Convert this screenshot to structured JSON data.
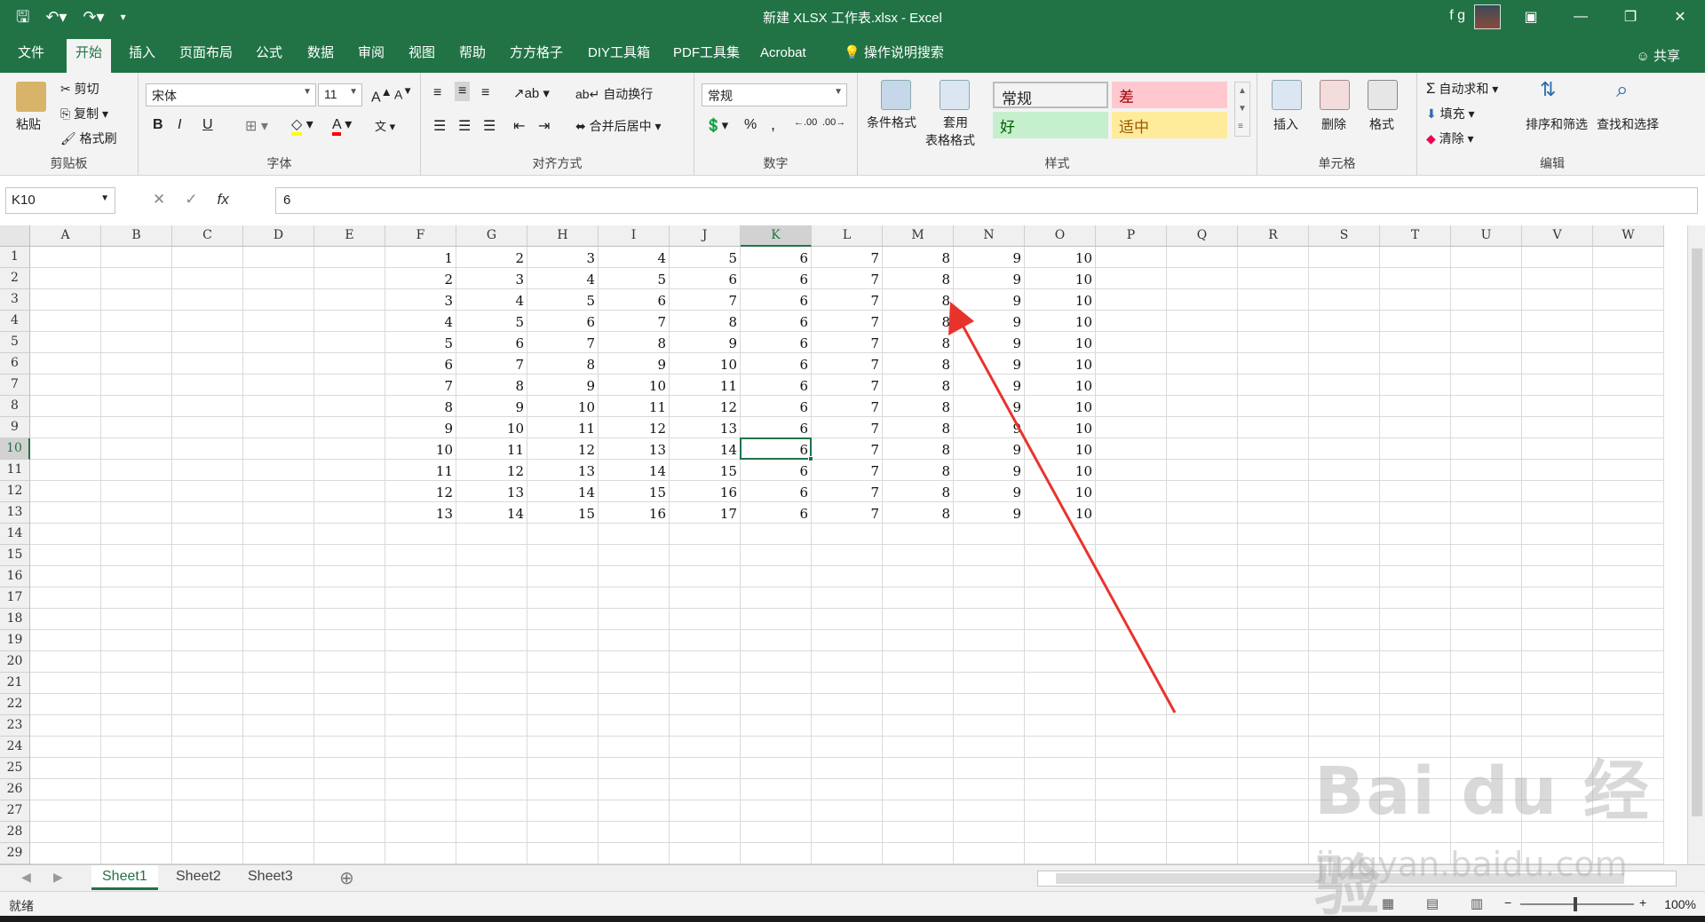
{
  "titlebar": {
    "title": "新建 XLSX 工作表.xlsx  -  Excel",
    "user": "f g",
    "qat": [
      "save-icon",
      "undo-icon",
      "redo-icon",
      "customize-icon"
    ],
    "window_buttons": [
      "ribbon-display-icon",
      "minimize-icon",
      "restore-icon",
      "close-icon"
    ]
  },
  "tabs": [
    "文件",
    "开始",
    "插入",
    "页面布局",
    "公式",
    "数据",
    "审阅",
    "视图",
    "帮助",
    "方方格子",
    "DIY工具箱",
    "PDF工具集",
    "Acrobat",
    "操作说明搜索"
  ],
  "active_tab": "开始",
  "share_label": "共享",
  "ribbon": {
    "clipboard": {
      "label": "剪贴板",
      "paste": "粘贴",
      "cut": "剪切",
      "copy": "复制",
      "format_painter": "格式刷"
    },
    "font": {
      "label": "字体",
      "font_name": "宋体",
      "font_size": "11",
      "bold": "B",
      "italic": "I",
      "underline": "U"
    },
    "alignment": {
      "label": "对齐方式",
      "wrap": "自动换行",
      "merge": "合并后居中"
    },
    "number": {
      "label": "数字",
      "format": "常规",
      "percent": "%",
      "comma": ","
    },
    "styles": {
      "label": "样式",
      "conditional": "条件格式",
      "table_line1": "套用",
      "table_line2": "表格格式",
      "cells": [
        {
          "label": "常规",
          "bg": "#ffffff",
          "fg": "#222222"
        },
        {
          "label": "差",
          "bg": "#ffc7ce",
          "fg": "#9c0006"
        },
        {
          "label": "好",
          "bg": "#c6efce",
          "fg": "#006100"
        },
        {
          "label": "适中",
          "bg": "#ffeb9c",
          "fg": "#9c5700"
        }
      ]
    },
    "cells_group": {
      "label": "单元格",
      "insert": "插入",
      "delete": "删除",
      "format": "格式"
    },
    "editing": {
      "label": "编辑",
      "autosum": "自动求和",
      "fill": "填充",
      "clear": "清除",
      "sort": "排序和筛选",
      "find": "查找和选择"
    }
  },
  "formula_bar": {
    "name_box": "K10",
    "cancel": "✕",
    "enter": "✓",
    "fx": "fx",
    "value": "6"
  },
  "columns": [
    "A",
    "B",
    "C",
    "D",
    "E",
    "F",
    "G",
    "H",
    "I",
    "J",
    "K",
    "L",
    "M",
    "N",
    "O",
    "P",
    "Q",
    "R",
    "S",
    "T",
    "U",
    "V",
    "W"
  ],
  "selected_column": "K",
  "rows": [
    "1",
    "2",
    "3",
    "4",
    "5",
    "6",
    "7",
    "8",
    "9",
    "10",
    "11",
    "12",
    "13",
    "14",
    "15",
    "16",
    "17",
    "18",
    "19",
    "20",
    "21",
    "22",
    "23",
    "24",
    "25",
    "26",
    "27",
    "28",
    "29"
  ],
  "selected_row": "10",
  "cells": {
    "first_col": "F",
    "values": [
      [
        "1",
        "2",
        "3",
        "4",
        "5",
        "6",
        "7",
        "8",
        "9",
        "10"
      ],
      [
        "2",
        "3",
        "4",
        "5",
        "6",
        "6",
        "7",
        "8",
        "9",
        "10"
      ],
      [
        "3",
        "4",
        "5",
        "6",
        "7",
        "6",
        "7",
        "8",
        "9",
        "10"
      ],
      [
        "4",
        "5",
        "6",
        "7",
        "8",
        "6",
        "7",
        "8",
        "9",
        "10"
      ],
      [
        "5",
        "6",
        "7",
        "8",
        "9",
        "6",
        "7",
        "8",
        "9",
        "10"
      ],
      [
        "6",
        "7",
        "8",
        "9",
        "10",
        "6",
        "7",
        "8",
        "9",
        "10"
      ],
      [
        "7",
        "8",
        "9",
        "10",
        "11",
        "6",
        "7",
        "8",
        "9",
        "10"
      ],
      [
        "8",
        "9",
        "10",
        "11",
        "12",
        "6",
        "7",
        "8",
        "9",
        "10"
      ],
      [
        "9",
        "10",
        "11",
        "12",
        "13",
        "6",
        "7",
        "8",
        "9",
        "10"
      ],
      [
        "10",
        "11",
        "12",
        "13",
        "14",
        "6",
        "7",
        "8",
        "9",
        "10"
      ],
      [
        "11",
        "12",
        "13",
        "14",
        "15",
        "6",
        "7",
        "8",
        "9",
        "10"
      ],
      [
        "12",
        "13",
        "14",
        "15",
        "16",
        "6",
        "7",
        "8",
        "9",
        "10"
      ],
      [
        "13",
        "14",
        "15",
        "16",
        "17",
        "6",
        "7",
        "8",
        "9",
        "10"
      ]
    ]
  },
  "sheets": [
    "Sheet1",
    "Sheet2",
    "Sheet3"
  ],
  "active_sheet": "Sheet1",
  "status": {
    "text": "就绪",
    "zoom": "100%"
  },
  "watermark": {
    "line1": "Bai du 经验",
    "line2": "jingyan.baidu.com"
  },
  "colors": {
    "accent": "#217346",
    "arrow": "#e8332d"
  }
}
